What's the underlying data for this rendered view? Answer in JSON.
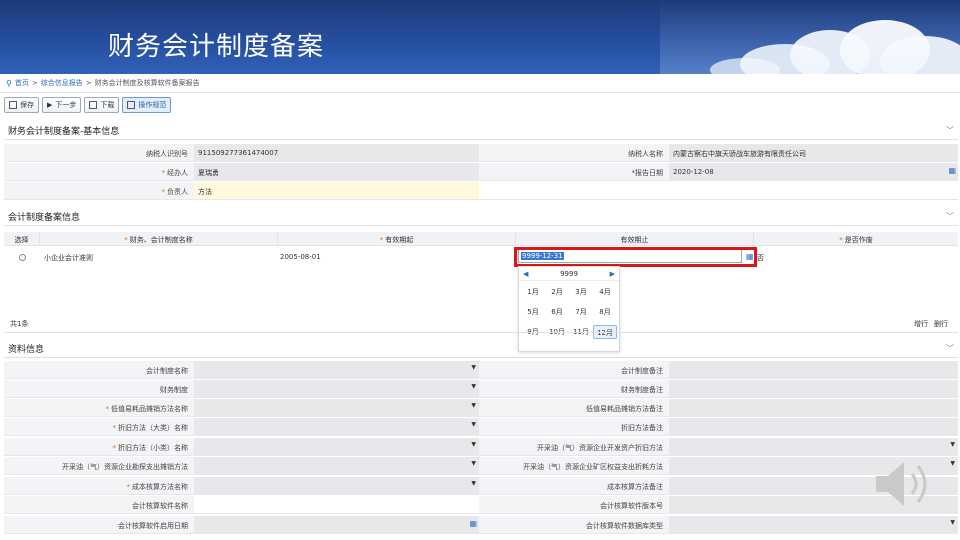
{
  "slide": {
    "title": "财务会计制度备案"
  },
  "breadcrumb": {
    "home": "首页",
    "section": "综合信息报告",
    "current": "财务会计制度及核算软件备案报告",
    "sep": ">"
  },
  "toolbar": {
    "save": "保存",
    "next": "下一步",
    "download": "下载",
    "guide": "操作规范"
  },
  "basic": {
    "title": "财务会计制度备案-基本信息",
    "tax_id_label": "纳税人识别号",
    "tax_id": "911509277361474007",
    "taxpayer_name_label": "纳税人名称",
    "taxpayer_name": "内蒙古察右中旗天骄战车旅游有限责任公司",
    "handler_label": "经办人",
    "handler": "夏瑞勇",
    "report_date_label": "报告日期",
    "report_date": "2020-12-08",
    "principal_label": "负责人",
    "principal": "方法"
  },
  "filing": {
    "title": "会计制度备案信息",
    "headers": {
      "select": "选择",
      "name": "财务、会计制度名称",
      "start": "有效期起",
      "end": "有效期止",
      "negate": "是否作废"
    },
    "row": {
      "name": "小企业会计准则",
      "start": "2005-08-01",
      "end": "9999-12-31",
      "negate": "否"
    },
    "total": "共1条",
    "add_row": "增行",
    "delete_row": "删行"
  },
  "picker": {
    "year": "9999",
    "prev": "◀",
    "next": "▶",
    "months": [
      "1月",
      "2月",
      "3月",
      "4月",
      "5月",
      "6月",
      "7月",
      "8月",
      "9月",
      "10月",
      "11月",
      "12月"
    ]
  },
  "materials": {
    "title": "资料信息",
    "rows": [
      {
        "left": "会计制度名称",
        "left_req": false,
        "right": "会计制度备注"
      },
      {
        "left": "财务制度",
        "left_req": false,
        "right": "财务制度备注"
      },
      {
        "left": "低值易耗品摊销方法名称",
        "left_req": true,
        "right": "低值易耗品摊销方法备注"
      },
      {
        "left": "折旧方法（大类）名称",
        "left_req": true,
        "right": "折旧方法备注"
      },
      {
        "left": "折旧方法（小类）名称",
        "left_req": true,
        "right": "开采油（气）资源企业开发资产折旧方法"
      },
      {
        "left": "开采油（气）资源企业勘探支出摊销方法",
        "left_req": false,
        "right": "开采油（气）资源企业矿区权益支出折耗方法"
      },
      {
        "left": "成本核算方法名称",
        "left_req": true,
        "right": "成本核算方法备注"
      },
      {
        "left": "会计核算软件名称",
        "left_req": false,
        "right": "会计核算软件版本号"
      },
      {
        "left": "会计核算软件启用日期",
        "left_req": false,
        "right": "会计核算软件数据库类型"
      }
    ]
  },
  "colors": {
    "banner": "#254e9e",
    "accent": "#2a6ebd",
    "highlight": "#d81818",
    "required": "#e06a1a"
  }
}
